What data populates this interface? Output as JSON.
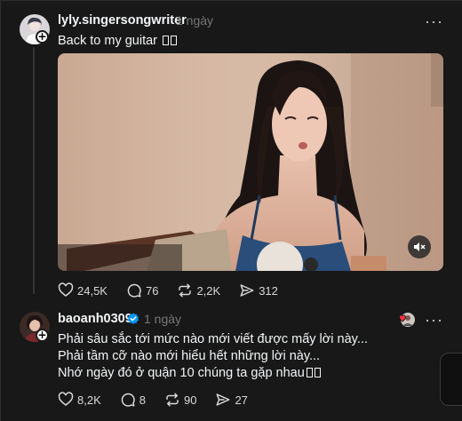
{
  "post": {
    "username": "lyly.singersongwriter",
    "time": "1 ngày",
    "text": "Back to my guitar",
    "more": "···",
    "stats": {
      "likes": "24,5K",
      "replies": "76",
      "reposts": "2,2K",
      "shares": "312"
    }
  },
  "reply": {
    "username": "baoanh0309",
    "time": "1 ngày",
    "more": "···",
    "lines": [
      "Phải sâu sắc tới mức nào mới viết được mấy lời này...",
      "Phải tầm cỡ nào mới hiểu hết những lời này...",
      "Nhớ ngày đó ở quận 10 chúng ta gặp nhau"
    ],
    "stats": {
      "likes": "8,2K",
      "replies": "8",
      "reposts": "90",
      "shares": "27"
    }
  },
  "icons": {
    "like": "heart-icon",
    "reply": "speech-bubble-icon",
    "repost": "repost-icon",
    "share": "send-icon",
    "mute": "speaker-muted-icon",
    "verified": "verified-badge-icon",
    "follow": "plus-icon"
  },
  "colors": {
    "background": "#181818",
    "text": "#f3f5f7",
    "muted": "#777777",
    "verified": "#0095f6"
  }
}
